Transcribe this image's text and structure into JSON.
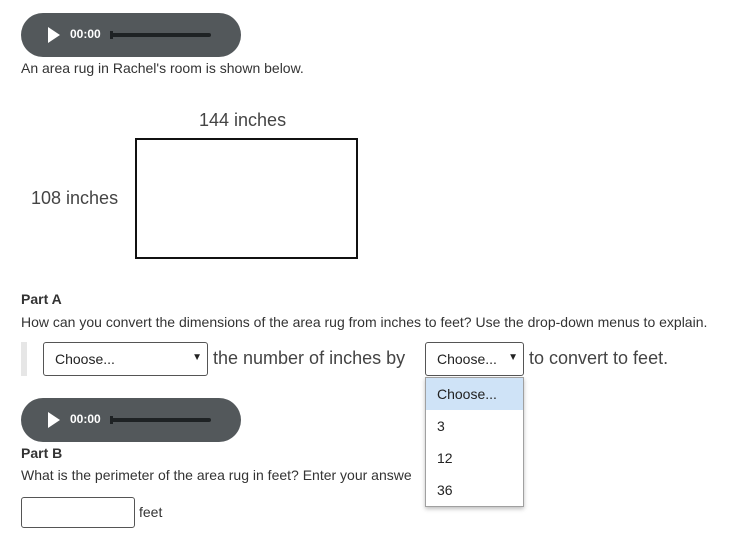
{
  "audio_players": [
    {
      "time": "00:00"
    },
    {
      "time": "00:00"
    }
  ],
  "intro_text": "An area rug in Rachel's room is shown below.",
  "figure": {
    "width_label": "144 inches",
    "height_label": "108 inches"
  },
  "part_a": {
    "heading": "Part A",
    "question": "How can you convert the dimensions of the area rug from inches to feet? Use the drop-down menus to explain.",
    "select1_value": "Choose...",
    "text1": "the number of inches by",
    "select2_value": "Choose...",
    "text2": "to convert to feet.",
    "dropdown_options": [
      "Choose...",
      "3",
      "12",
      "36"
    ]
  },
  "part_b": {
    "heading": "Part B",
    "question": "What is the perimeter of the area rug in feet? Enter your answe",
    "unit": "feet",
    "answer_value": ""
  },
  "colors": {
    "player_bg": "#53585b",
    "dropdown_highlight": "#cfe3f7",
    "text": "#333333"
  }
}
